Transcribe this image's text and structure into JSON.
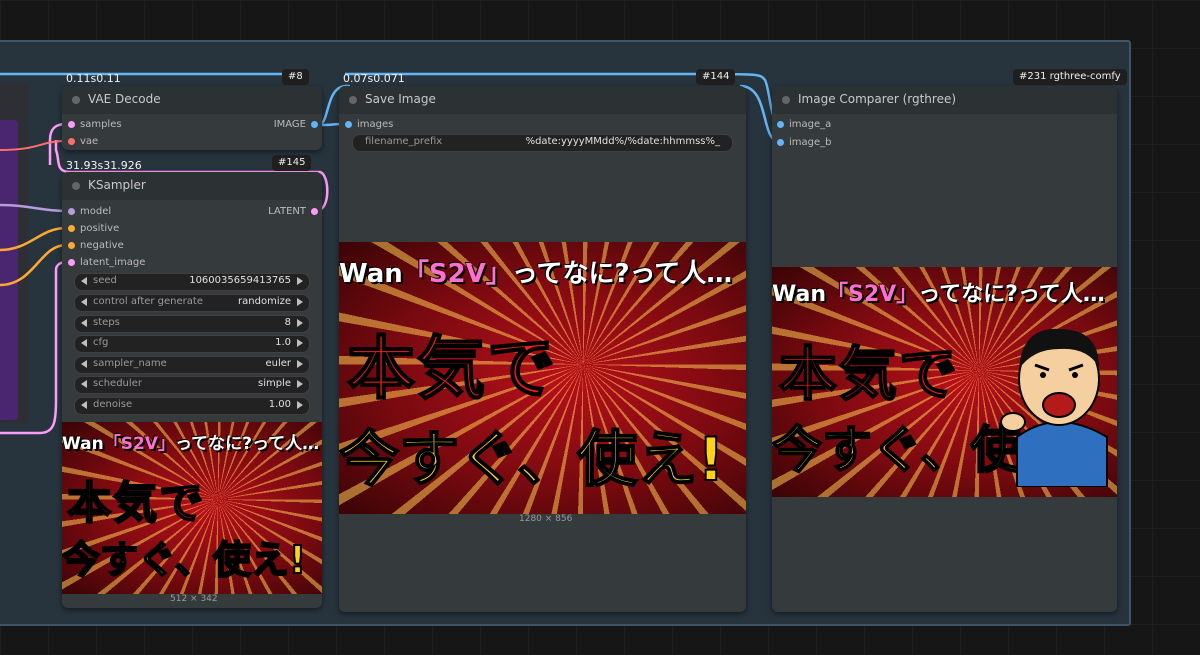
{
  "nodes": {
    "vae_decode": {
      "title": "VAE Decode",
      "id_badge": "#8",
      "timing": "0.11s0.11",
      "inputs": [
        "samples",
        "vae"
      ],
      "output": "IMAGE"
    },
    "ksampler": {
      "title": "KSampler",
      "id_badge": "#145",
      "timing": "31.93s31.926",
      "inputs": [
        "model",
        "positive",
        "negative",
        "latent_image"
      ],
      "output": "LATENT",
      "widgets": [
        {
          "label": "seed",
          "value": "1060035659413765"
        },
        {
          "label": "control after generate",
          "value": "randomize"
        },
        {
          "label": "steps",
          "value": "8"
        },
        {
          "label": "cfg",
          "value": "1.0"
        },
        {
          "label": "sampler_name",
          "value": "euler"
        },
        {
          "label": "scheduler",
          "value": "simple"
        },
        {
          "label": "denoise",
          "value": "1.00"
        }
      ],
      "preview_size": "512 × 342"
    },
    "save_image": {
      "title": "Save Image",
      "id_badge": "#144",
      "timing": "0.07s0.071",
      "inputs": [
        "images"
      ],
      "widget": {
        "label": "filename_prefix",
        "value": "%date:yyyyMMdd%/%date:hhmmss%_"
      },
      "preview_size": "1280 × 856"
    },
    "image_comparer": {
      "title": "Image Comparer (rgthree)",
      "id_badge": "#231 rgthree-comfy",
      "inputs": [
        "image_a",
        "image_b"
      ]
    }
  },
  "thumbnail": {
    "line1_a": "Wan",
    "line1_b": "「S2V」",
    "line1_c": "ってなに?って人…",
    "line2": "本気で",
    "line3": "今すぐ、使え!"
  },
  "colors": {
    "background": "#161616",
    "group": "#27343e",
    "node": "#353a3d",
    "image_wire": "#64b5f6",
    "latent_wire": "#ff9cf9",
    "conditioning_wire": "#ffa931",
    "model_wire": "#b39ddb",
    "vae_wire": "#ff6e6e"
  }
}
